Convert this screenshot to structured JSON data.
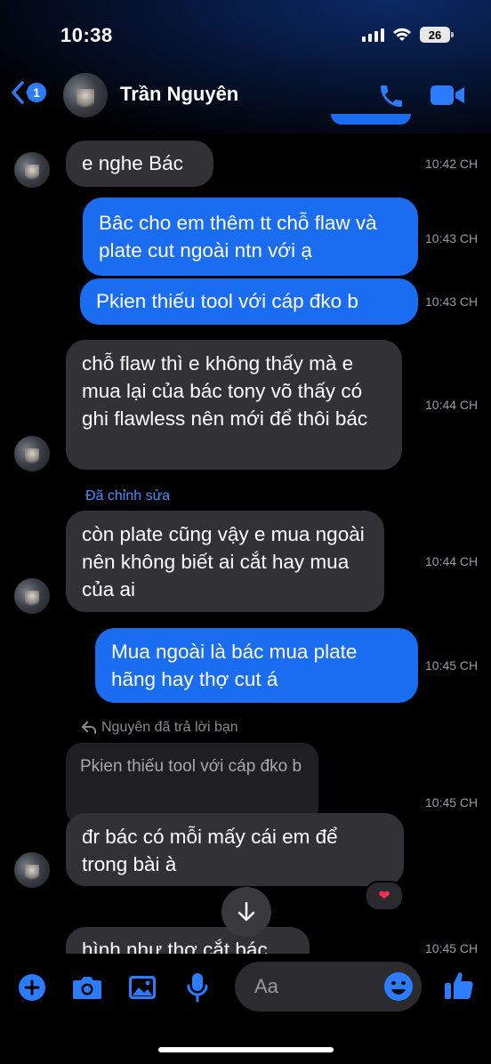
{
  "status": {
    "time": "10:38",
    "battery": "26"
  },
  "header": {
    "back_badge": "1",
    "contact_name": "Trần Nguyên"
  },
  "messages": [
    {
      "side": "in",
      "text": "e nghe Bác",
      "time": "10:42 CH"
    },
    {
      "side": "out",
      "text": "Bâc cho em thêm tt chỗ flaw và plate cut ngoài ntn với ạ",
      "time": "10:43 CH"
    },
    {
      "side": "out",
      "text": "Pkien thiếu tool với cáp đko b",
      "time": "10:43 CH"
    },
    {
      "side": "in",
      "text": "chỗ flaw thì e không thấy mà e mua lại của bác tony võ thấy có ghi flawless nên mới để thôi bác",
      "time": "10:44 CH"
    },
    {
      "side": "in",
      "edited_label": "Đã chỉnh sửa",
      "text": "còn plate cũng vậy e mua ngoài nên không biết ai cắt hay mua của ai",
      "time": "10:44 CH"
    },
    {
      "side": "out",
      "text": "Mua ngoài là bác mua plate hãng hay thợ cut á",
      "time": "10:45 CH"
    },
    {
      "side": "in",
      "reply_meta": "Nguyên đã trả lời bạn",
      "quoted": "Pkien thiếu tool với cáp đko b",
      "text": "đr bác có mỗi mấy cái em để trong bài à",
      "time": "10:45 CH",
      "reaction": "❤"
    },
    {
      "side": "in",
      "text": "hình như thợ cắt bác",
      "time": "10:45 CH"
    }
  ],
  "composer": {
    "placeholder": "Aa"
  },
  "colors": {
    "accent": "#1a6cf0",
    "incoming": "#323236",
    "icon_blue": "#2b7cff"
  }
}
